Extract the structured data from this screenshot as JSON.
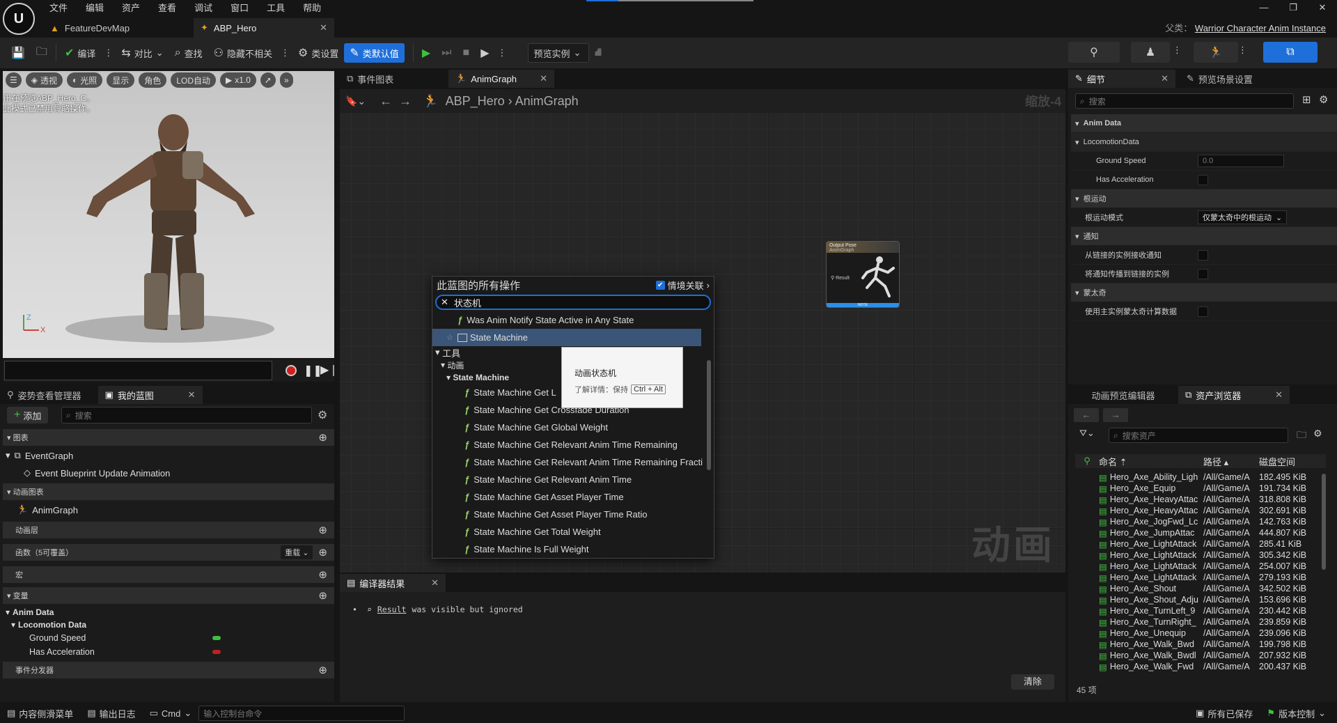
{
  "menu": [
    "文件",
    "编辑",
    "资产",
    "查看",
    "调试",
    "窗口",
    "工具",
    "帮助"
  ],
  "doc_tabs": [
    {
      "label": "FeatureDevMap"
    },
    {
      "label": "ABP_Hero"
    }
  ],
  "parent_class": {
    "label": "父类：",
    "value": "Warrior Character Anim Instance"
  },
  "toolbar": {
    "compile": "编译",
    "diff": "对比",
    "find": "查找",
    "hide_unrelated": "隐藏不相关",
    "class_settings": "类设置",
    "class_defaults": "类默认值",
    "preview_instance": "预览实例"
  },
  "viewport": {
    "buttons": [
      "透视",
      "光照",
      "显示",
      "角色",
      "LOD自动",
      "x1.0"
    ],
    "message": [
      "正在预览ABP_Hero_C。",
      "此模式已禁用骨骼操作。"
    ],
    "axes": {
      "x": "X",
      "z": "Z"
    }
  },
  "left_panel": {
    "tabs": [
      {
        "label": "姿势查看管理器"
      },
      {
        "label": "我的蓝图"
      }
    ],
    "add_label": "添加",
    "search_placeholder": "搜索",
    "sections": {
      "graphs": "图表",
      "event_graph": "EventGraph",
      "event_bp": "Event Blueprint Update Animation",
      "anim_graphs": "动画图表",
      "anim_graph": "AnimGraph",
      "anim_layers": "动画层",
      "functions": "函数（5可覆盖）",
      "override": "重载",
      "macros": "宏",
      "variables": "变量",
      "anim_data": "Anim Data",
      "locomotion_data": "Locomotion Data",
      "ground_speed": "Ground Speed",
      "has_acceleration": "Has Acceleration",
      "event_dispatchers": "事件分发器"
    }
  },
  "graph": {
    "tabs": [
      {
        "label": "事件图表"
      },
      {
        "label": "AnimGraph"
      }
    ],
    "breadcrumb": [
      "ABP_Hero",
      "AnimGraph"
    ],
    "zoom": "缩放-4",
    "watermark": "动画",
    "node": {
      "title": "Output Pose",
      "subtitle": "AnimGraph",
      "pin": "Result",
      "footer": "NOTE"
    }
  },
  "action_menu": {
    "title": "此蓝图的所有操作",
    "context_label": "情境关联",
    "search_value": "状态机",
    "items": [
      "Was Anim Notify State Active in Any State",
      "State Machine"
    ],
    "cat_tools": "工具",
    "cat_anim": "动画",
    "cat_sm": "State Machine",
    "functions": [
      "State Machine Get L",
      "State Machine Get Crossfade Duration",
      "State Machine Get Global Weight",
      "State Machine Get Relevant Anim Time Remaining",
      "State Machine Get Relevant Anim Time Remaining Fracti",
      "State Machine Get Relevant Anim Time",
      "State Machine Get Asset Player Time",
      "State Machine Get Asset Player Time Ratio",
      "State Machine Get Total Weight",
      "State Machine Is Full Weight"
    ]
  },
  "tooltip": {
    "title": "动画状态机",
    "hint": "了解详情：保持",
    "shortcut": "Ctrl + Alt"
  },
  "compiler": {
    "tab": "编译器结果",
    "result_link": "Result",
    "result_text": "was visible but ignored",
    "clear": "清除"
  },
  "details": {
    "tabs": [
      {
        "label": "细节"
      },
      {
        "label": "预览场景设置"
      }
    ],
    "search_placeholder": "搜索",
    "anim_data": "Anim Data",
    "locomotion_data": "LocomotionData",
    "ground_speed": "Ground Speed",
    "ground_speed_value": "0.0",
    "has_acceleration": "Has Acceleration",
    "root_motion": "根运动",
    "root_motion_mode": "根运动模式",
    "root_motion_mode_value": "仅蒙太奇中的根运动",
    "notifies": "通知",
    "receive_notifies": "从链接的实例接收通知",
    "propagate_notifies": "将通知传播到链接的实例",
    "montage": "蒙太奇",
    "use_main_montage": "使用主实例蒙太奇计算数据"
  },
  "asset_browser": {
    "tabs": [
      {
        "label": "动画预览编辑器"
      },
      {
        "label": "资产浏览器"
      }
    ],
    "search_placeholder": "搜索资产",
    "columns": [
      "命名",
      "路径",
      "磁盘空间"
    ],
    "rows": [
      {
        "name": "Hero_Axe_Ability_Ligh",
        "path": "/All/Game/A",
        "size": "182.495 KiB"
      },
      {
        "name": "Hero_Axe_Equip",
        "path": "/All/Game/A",
        "size": "191.734 KiB"
      },
      {
        "name": "Hero_Axe_HeavyAttac",
        "path": "/All/Game/A",
        "size": "318.808 KiB"
      },
      {
        "name": "Hero_Axe_HeavyAttac",
        "path": "/All/Game/A",
        "size": "302.691 KiB"
      },
      {
        "name": "Hero_Axe_JogFwd_Lc",
        "path": "/All/Game/A",
        "size": "142.763 KiB"
      },
      {
        "name": "Hero_Axe_JumpAttac",
        "path": "/All/Game/A",
        "size": "444.807 KiB"
      },
      {
        "name": "Hero_Axe_LightAttack",
        "path": "/All/Game/A",
        "size": "285.41 KiB"
      },
      {
        "name": "Hero_Axe_LightAttack",
        "path": "/All/Game/A",
        "size": "305.342 KiB"
      },
      {
        "name": "Hero_Axe_LightAttack",
        "path": "/All/Game/A",
        "size": "254.007 KiB"
      },
      {
        "name": "Hero_Axe_LightAttack",
        "path": "/All/Game/A",
        "size": "279.193 KiB"
      },
      {
        "name": "Hero_Axe_Shout",
        "path": "/All/Game/A",
        "size": "342.502 KiB"
      },
      {
        "name": "Hero_Axe_Shout_Adju",
        "path": "/All/Game/A",
        "size": "153.696 KiB"
      },
      {
        "name": "Hero_Axe_TurnLeft_9",
        "path": "/All/Game/A",
        "size": "230.442 KiB"
      },
      {
        "name": "Hero_Axe_TurnRight_",
        "path": "/All/Game/A",
        "size": "239.859 KiB"
      },
      {
        "name": "Hero_Axe_Unequip",
        "path": "/All/Game/A",
        "size": "239.096 KiB"
      },
      {
        "name": "Hero_Axe_Walk_Bwd",
        "path": "/All/Game/A",
        "size": "199.798 KiB"
      },
      {
        "name": "Hero_Axe_Walk_Bwdl",
        "path": "/All/Game/A",
        "size": "207.932 KiB"
      },
      {
        "name": "Hero_Axe_Walk_Fwd",
        "path": "/All/Game/A",
        "size": "200.437 KiB"
      }
    ],
    "count": "45 项"
  },
  "statusbar": {
    "content_drawer": "内容侧滑菜单",
    "output_log": "输出日志",
    "cmd": "Cmd",
    "console_placeholder": "输入控制台命令",
    "all_saved": "所有已保存",
    "source_control": "版本控制"
  },
  "colors": {
    "accent": "#1e6fd9",
    "green": "#3fbf3f",
    "red": "#c02020",
    "fn": "#9bd36b"
  }
}
